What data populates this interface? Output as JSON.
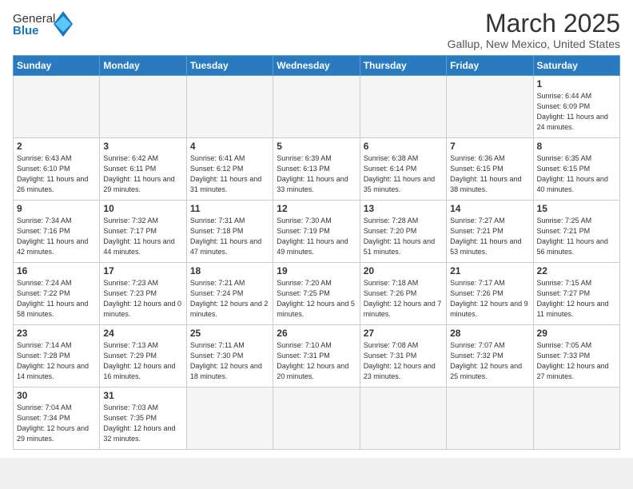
{
  "header": {
    "logo_general": "General",
    "logo_blue": "Blue",
    "month_title": "March 2025",
    "location": "Gallup, New Mexico, United States"
  },
  "weekdays": [
    "Sunday",
    "Monday",
    "Tuesday",
    "Wednesday",
    "Thursday",
    "Friday",
    "Saturday"
  ],
  "weeks": [
    [
      {
        "day": "",
        "info": ""
      },
      {
        "day": "",
        "info": ""
      },
      {
        "day": "",
        "info": ""
      },
      {
        "day": "",
        "info": ""
      },
      {
        "day": "",
        "info": ""
      },
      {
        "day": "",
        "info": ""
      },
      {
        "day": "1",
        "info": "Sunrise: 6:44 AM\nSunset: 6:09 PM\nDaylight: 11 hours\nand 24 minutes."
      }
    ],
    [
      {
        "day": "2",
        "info": "Sunrise: 6:43 AM\nSunset: 6:10 PM\nDaylight: 11 hours\nand 26 minutes."
      },
      {
        "day": "3",
        "info": "Sunrise: 6:42 AM\nSunset: 6:11 PM\nDaylight: 11 hours\nand 29 minutes."
      },
      {
        "day": "4",
        "info": "Sunrise: 6:41 AM\nSunset: 6:12 PM\nDaylight: 11 hours\nand 31 minutes."
      },
      {
        "day": "5",
        "info": "Sunrise: 6:39 AM\nSunset: 6:13 PM\nDaylight: 11 hours\nand 33 minutes."
      },
      {
        "day": "6",
        "info": "Sunrise: 6:38 AM\nSunset: 6:14 PM\nDaylight: 11 hours\nand 35 minutes."
      },
      {
        "day": "7",
        "info": "Sunrise: 6:36 AM\nSunset: 6:15 PM\nDaylight: 11 hours\nand 38 minutes."
      },
      {
        "day": "8",
        "info": "Sunrise: 6:35 AM\nSunset: 6:15 PM\nDaylight: 11 hours\nand 40 minutes."
      }
    ],
    [
      {
        "day": "9",
        "info": "Sunrise: 7:34 AM\nSunset: 7:16 PM\nDaylight: 11 hours\nand 42 minutes."
      },
      {
        "day": "10",
        "info": "Sunrise: 7:32 AM\nSunset: 7:17 PM\nDaylight: 11 hours\nand 44 minutes."
      },
      {
        "day": "11",
        "info": "Sunrise: 7:31 AM\nSunset: 7:18 PM\nDaylight: 11 hours\nand 47 minutes."
      },
      {
        "day": "12",
        "info": "Sunrise: 7:30 AM\nSunset: 7:19 PM\nDaylight: 11 hours\nand 49 minutes."
      },
      {
        "day": "13",
        "info": "Sunrise: 7:28 AM\nSunset: 7:20 PM\nDaylight: 11 hours\nand 51 minutes."
      },
      {
        "day": "14",
        "info": "Sunrise: 7:27 AM\nSunset: 7:21 PM\nDaylight: 11 hours\nand 53 minutes."
      },
      {
        "day": "15",
        "info": "Sunrise: 7:25 AM\nSunset: 7:21 PM\nDaylight: 11 hours\nand 56 minutes."
      }
    ],
    [
      {
        "day": "16",
        "info": "Sunrise: 7:24 AM\nSunset: 7:22 PM\nDaylight: 11 hours\nand 58 minutes."
      },
      {
        "day": "17",
        "info": "Sunrise: 7:23 AM\nSunset: 7:23 PM\nDaylight: 12 hours\nand 0 minutes."
      },
      {
        "day": "18",
        "info": "Sunrise: 7:21 AM\nSunset: 7:24 PM\nDaylight: 12 hours\nand 2 minutes."
      },
      {
        "day": "19",
        "info": "Sunrise: 7:20 AM\nSunset: 7:25 PM\nDaylight: 12 hours\nand 5 minutes."
      },
      {
        "day": "20",
        "info": "Sunrise: 7:18 AM\nSunset: 7:26 PM\nDaylight: 12 hours\nand 7 minutes."
      },
      {
        "day": "21",
        "info": "Sunrise: 7:17 AM\nSunset: 7:26 PM\nDaylight: 12 hours\nand 9 minutes."
      },
      {
        "day": "22",
        "info": "Sunrise: 7:15 AM\nSunset: 7:27 PM\nDaylight: 12 hours\nand 11 minutes."
      }
    ],
    [
      {
        "day": "23",
        "info": "Sunrise: 7:14 AM\nSunset: 7:28 PM\nDaylight: 12 hours\nand 14 minutes."
      },
      {
        "day": "24",
        "info": "Sunrise: 7:13 AM\nSunset: 7:29 PM\nDaylight: 12 hours\nand 16 minutes."
      },
      {
        "day": "25",
        "info": "Sunrise: 7:11 AM\nSunset: 7:30 PM\nDaylight: 12 hours\nand 18 minutes."
      },
      {
        "day": "26",
        "info": "Sunrise: 7:10 AM\nSunset: 7:31 PM\nDaylight: 12 hours\nand 20 minutes."
      },
      {
        "day": "27",
        "info": "Sunrise: 7:08 AM\nSunset: 7:31 PM\nDaylight: 12 hours\nand 23 minutes."
      },
      {
        "day": "28",
        "info": "Sunrise: 7:07 AM\nSunset: 7:32 PM\nDaylight: 12 hours\nand 25 minutes."
      },
      {
        "day": "29",
        "info": "Sunrise: 7:05 AM\nSunset: 7:33 PM\nDaylight: 12 hours\nand 27 minutes."
      }
    ],
    [
      {
        "day": "30",
        "info": "Sunrise: 7:04 AM\nSunset: 7:34 PM\nDaylight: 12 hours\nand 29 minutes."
      },
      {
        "day": "31",
        "info": "Sunrise: 7:03 AM\nSunset: 7:35 PM\nDaylight: 12 hours\nand 32 minutes."
      },
      {
        "day": "",
        "info": ""
      },
      {
        "day": "",
        "info": ""
      },
      {
        "day": "",
        "info": ""
      },
      {
        "day": "",
        "info": ""
      },
      {
        "day": "",
        "info": ""
      }
    ]
  ]
}
